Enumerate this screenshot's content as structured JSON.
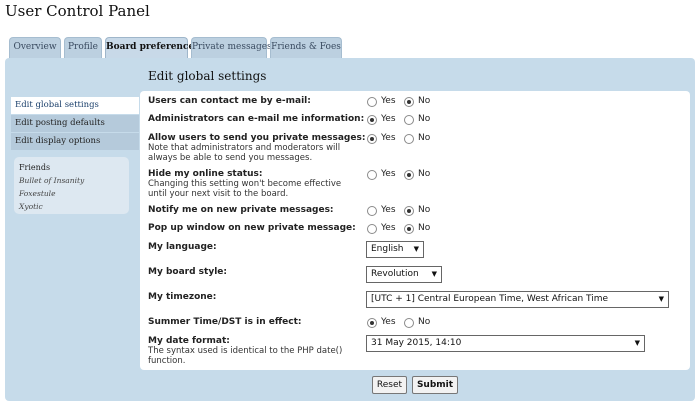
{
  "title": "User Control Panel",
  "tabs": [
    {
      "label": "Overview"
    },
    {
      "label": "Profile"
    },
    {
      "label": "Board preferences",
      "active": true
    },
    {
      "label": "Private messages"
    },
    {
      "label": "Friends & Foes"
    }
  ],
  "sidebar": {
    "items": [
      {
        "label": "Edit global settings",
        "active": true
      },
      {
        "label": "Edit posting defaults"
      },
      {
        "label": "Edit display options"
      }
    ],
    "friends": {
      "title": "Friends",
      "names": [
        "Bullet of Insanity",
        "Foxestule",
        "Xyotic"
      ]
    }
  },
  "main": {
    "heading": "Edit global settings",
    "settings": [
      {
        "label": "Users can contact me by e-mail:",
        "yes": "Yes",
        "no": "No",
        "selected": "no"
      },
      {
        "label": "Administrators can e-mail me information:",
        "yes": "Yes",
        "no": "No",
        "selected": "yes"
      },
      {
        "label": "Allow users to send you private messages:",
        "note1": "Note that administrators and moderators will",
        "note2": "always be able to send you messages.",
        "yes": "Yes",
        "no": "No",
        "selected": "yes"
      },
      {
        "label": "Hide my online status:",
        "note1": "Changing this setting won't become effective",
        "note2": "until your next visit to the board.",
        "yes": "Yes",
        "no": "No",
        "selected": "no"
      },
      {
        "label": "Notify me on new private messages:",
        "yes": "Yes",
        "no": "No",
        "selected": "no"
      },
      {
        "label": "Pop up window on new private message:",
        "yes": "Yes",
        "no": "No",
        "selected": "no"
      }
    ],
    "language": {
      "label": "My language:",
      "value": "English"
    },
    "style": {
      "label": "My board style:",
      "value": "Revolution"
    },
    "timezone": {
      "label": "My timezone:",
      "value": "[UTC + 1] Central European Time, West African Time"
    },
    "dst": {
      "label": "Summer Time/DST is in effect:",
      "yes": "Yes",
      "no": "No",
      "selected": "yes"
    },
    "dateformat": {
      "label": "My date format:",
      "note1": "The syntax used is identical to the PHP date()",
      "note2": "function.",
      "value": "31 May 2015, 14:10"
    }
  },
  "buttons": {
    "reset": "Reset",
    "submit": "Submit"
  }
}
